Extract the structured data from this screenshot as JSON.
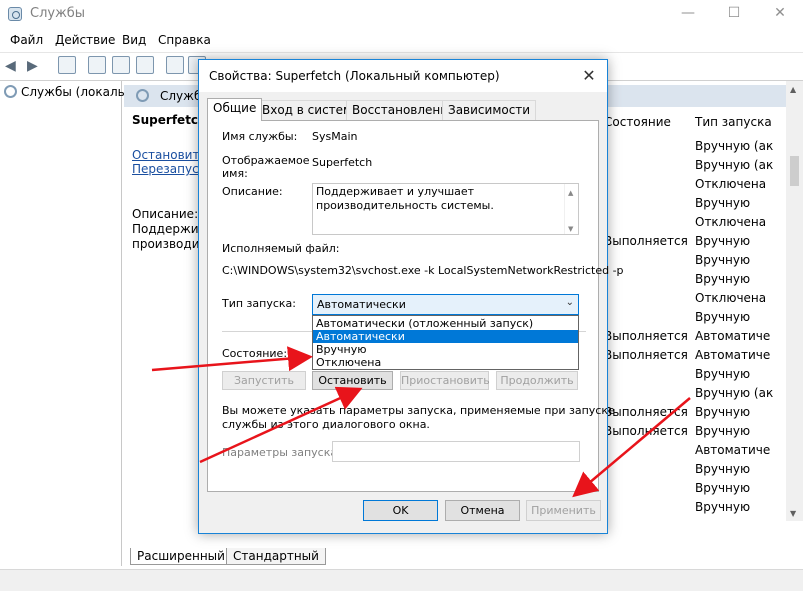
{
  "window": {
    "title": "Службы",
    "minimize": "—",
    "maximize": "☐",
    "close": "✕"
  },
  "menu": [
    "Файл",
    "Действие",
    "Вид",
    "Справка"
  ],
  "tree": {
    "item": "Службы (локалы"
  },
  "pane": {
    "header": "Служб",
    "service_name": "Superfetch",
    "link_stop": "Остановить",
    "link_restart": "Перезапуст",
    "desc_label": "Описание:",
    "desc_line1": "Поддержива",
    "desc_line2": "производите"
  },
  "columns": {
    "state": "Состояние",
    "startup": "Тип запуска"
  },
  "rows": [
    {
      "state": "",
      "startup": "Вручную (ак"
    },
    {
      "state": "",
      "startup": "Вручную (ак"
    },
    {
      "state": "",
      "startup": "Отключена"
    },
    {
      "state": "",
      "startup": "Вручную"
    },
    {
      "state": "",
      "startup": "Отключена"
    },
    {
      "state": "Выполняется",
      "startup": "Вручную"
    },
    {
      "state": "",
      "startup": "Вручную"
    },
    {
      "state": "",
      "startup": "Вручную"
    },
    {
      "state": "",
      "startup": "Отключена"
    },
    {
      "state": "",
      "startup": "Вручную"
    },
    {
      "state": "Выполняется",
      "startup": "Автоматиче"
    },
    {
      "state": "Выполняется",
      "startup": "Автоматиче"
    },
    {
      "state": "",
      "startup": "Вручную"
    },
    {
      "state": "",
      "startup": "Вручную (ак"
    },
    {
      "state": "Выполняется",
      "startup": "Вручную"
    },
    {
      "state": "Выполняется",
      "startup": "Вручную"
    },
    {
      "state": "",
      "startup": "Автоматиче"
    },
    {
      "state": "",
      "startup": "Вручную"
    },
    {
      "state": "",
      "startup": "Вручную"
    },
    {
      "state": "",
      "startup": "Вручную"
    }
  ],
  "bottom_tabs": [
    "Расширенный",
    "Стандартный"
  ],
  "dialog": {
    "title": "Свойства: Superfetch (Локальный компьютер)",
    "close": "✕",
    "tabs": [
      "Общие",
      "Вход в систему",
      "Восстановление",
      "Зависимости"
    ],
    "service_name_label": "Имя службы:",
    "service_name_value": "SysMain",
    "display_name_label1": "Отображаемое",
    "display_name_label2": "имя:",
    "display_name_value": "Superfetch",
    "description_label": "Описание:",
    "description_value": "Поддерживает и улучшает производительность системы.",
    "exe_label": "Исполняемый файл:",
    "exe_value": "C:\\WINDOWS\\system32\\svchost.exe -k LocalSystemNetworkRestricted -p",
    "startup_label": "Тип запуска:",
    "startup_selected": "Автоматически",
    "startup_options": [
      "Автоматически (отложенный запуск)",
      "Автоматически",
      "Вручную",
      "Отключена"
    ],
    "startup_highlight_index": 1,
    "state_label": "Состояние:",
    "btn_start": "Запустить",
    "btn_stop": "Остановить",
    "btn_pause": "Приостановить",
    "btn_resume": "Продолжить",
    "hint_line1": "Вы можете указать параметры запуска, применяемые при запуске",
    "hint_line2": "службы из этого диалогового окна.",
    "params_label": "Параметры запуска:",
    "params_value": "",
    "btn_ok": "OK",
    "btn_cancel": "Отмена",
    "btn_apply": "Применить"
  },
  "colors": {
    "accent": "#0078d7",
    "annotation_arrow": "#e8141b",
    "link": "#1a4fa0"
  }
}
